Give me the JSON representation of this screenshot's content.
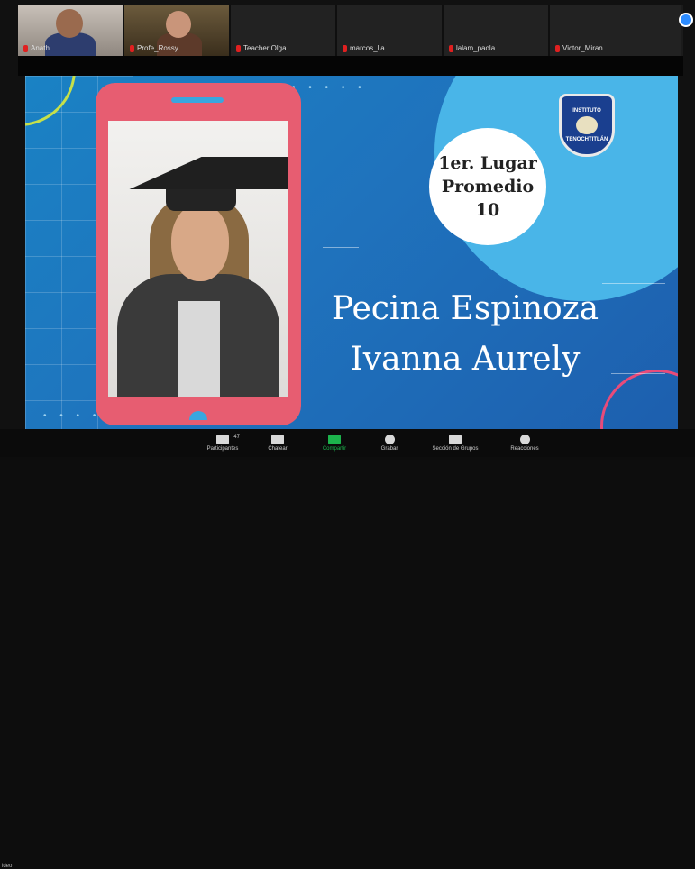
{
  "participants": [
    {
      "name": "Anath",
      "video": true
    },
    {
      "name": "Profe_Rossy",
      "video": true
    },
    {
      "name": "Teacher Olga",
      "video": false
    },
    {
      "name": "marcos_lla",
      "video": false
    },
    {
      "name": "lalam_paola",
      "video": false
    },
    {
      "name": "Victor_Miran",
      "video": false
    }
  ],
  "slide": {
    "award_line1": "1er. Lugar",
    "award_line2": "Promedio",
    "award_line3": "10",
    "student_line1": "Pecina Espinoza",
    "student_line2": "Ivanna Aurely",
    "badge_top": "INSTITUTO",
    "badge_bottom": "TENOCHTITLÁN"
  },
  "toolbar": {
    "participants_label": "Participantes",
    "participants_count": "47",
    "chat_label": "Chatear",
    "share_label": "Compartir",
    "record_label": "Grabar",
    "breakout_label": "Sección de Grupos",
    "reactions_label": "Reacciones",
    "left_label": "ideo"
  },
  "colors": {
    "share_green": "#1cb34c",
    "slide_blue": "#1f73bd",
    "phone_pink": "#e75d71",
    "mic_muted_red": "#e02020"
  }
}
